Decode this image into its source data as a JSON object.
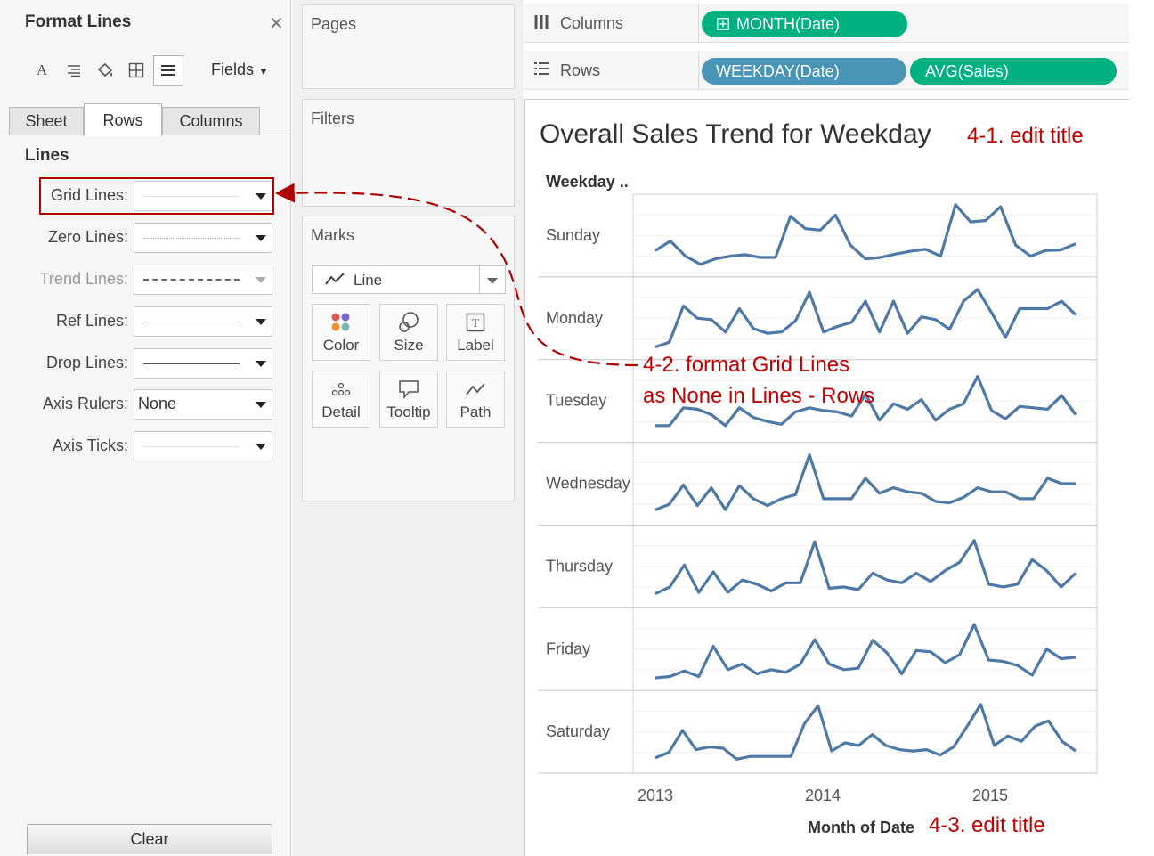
{
  "format_pane": {
    "title": "Format Lines",
    "toolbar_icons": [
      "font-icon",
      "alignment-icon",
      "shading-icon",
      "borders-icon",
      "lines-icon"
    ],
    "fields_label": "Fields",
    "tabs": [
      "Sheet",
      "Rows",
      "Columns"
    ],
    "active_tab": "Rows",
    "section_title": "Lines",
    "rows": [
      {
        "label": "Grid Lines:",
        "style": "faint",
        "value": ""
      },
      {
        "label": "Zero Lines:",
        "style": "dotted",
        "value": ""
      },
      {
        "label": "Trend Lines:",
        "style": "dashed",
        "value": "",
        "disabled": true
      },
      {
        "label": "Ref Lines:",
        "style": "solid",
        "value": ""
      },
      {
        "label": "Drop Lines:",
        "style": "solid",
        "value": ""
      },
      {
        "label": "Axis Rulers:",
        "style": "text",
        "value": "None"
      },
      {
        "label": "Axis Ticks:",
        "style": "faint",
        "value": ""
      }
    ],
    "clear_label": "Clear"
  },
  "cards": {
    "pages_title": "Pages",
    "filters_title": "Filters",
    "marks_title": "Marks",
    "mark_type": "Line",
    "mark_buttons": [
      "Color",
      "Size",
      "Label",
      "Detail",
      "Tooltip",
      "Path"
    ]
  },
  "shelves": {
    "columns_label": "Columns",
    "rows_label": "Rows",
    "columns_pills": [
      "MONTH(Date)"
    ],
    "rows_pills": [
      "WEEKDAY(Date)",
      "AVG(Sales)"
    ]
  },
  "viz": {
    "title": "Overall Sales Trend for Weekday",
    "row_header": "Weekday ..",
    "x_title": "Month of Date"
  },
  "annotations": {
    "a1": "4-1. edit title",
    "a2_line1": "4-2. format Grid Lines",
    "a2_line2": "as None in Lines - Rows",
    "a3": "4-3. edit title"
  },
  "colors": {
    "accent_line": "#4e79a7",
    "pill_green": "#00b180",
    "pill_blue": "#4a95b7",
    "annotation": "#c00000"
  },
  "chart_data": {
    "type": "line",
    "title": "Overall Sales Trend for Weekday",
    "xlabel": "Month of Date",
    "ylabel": "",
    "row_field": "Weekday ..",
    "x_ticks": [
      "2013",
      "2014",
      "2015"
    ],
    "x": [
      "2013-01",
      "2013-02",
      "2013-03",
      "2013-04",
      "2013-05",
      "2013-06",
      "2013-07",
      "2013-08",
      "2013-09",
      "2013-10",
      "2013-11",
      "2013-12",
      "2014-01",
      "2014-02",
      "2014-03",
      "2014-04",
      "2014-05",
      "2014-06",
      "2014-07",
      "2014-08",
      "2014-09",
      "2014-10",
      "2014-11",
      "2014-12",
      "2015-01",
      "2015-02",
      "2015-03",
      "2015-04",
      "2015-05",
      "2015-06",
      "2015-07"
    ],
    "panes": [
      {
        "name": "Sunday",
        "values": [
          0.28,
          0.42,
          0.2,
          0.08,
          0.16,
          0.2,
          0.22,
          0.18,
          0.18,
          0.78,
          0.6,
          0.58,
          0.8,
          0.36,
          0.16,
          0.18,
          0.23,
          0.27,
          0.3,
          0.2,
          0.95,
          0.7,
          0.72,
          0.92,
          0.36,
          0.2,
          0.28,
          0.29,
          0.38
        ]
      },
      {
        "name": "Monday",
        "values": [
          0.08,
          0.15,
          0.68,
          0.5,
          0.48,
          0.3,
          0.64,
          0.35,
          0.28,
          0.3,
          0.46,
          0.88,
          0.3,
          0.38,
          0.44,
          0.75,
          0.3,
          0.75,
          0.28,
          0.52,
          0.48,
          0.34,
          0.75,
          0.92,
          0.58,
          0.22,
          0.64,
          0.64,
          0.64,
          0.75,
          0.55
        ]
      },
      {
        "name": "Tuesday",
        "values": [
          0.14,
          0.14,
          0.4,
          0.38,
          0.3,
          0.14,
          0.4,
          0.26,
          0.2,
          0.16,
          0.34,
          0.4,
          0.36,
          0.34,
          0.28,
          0.6,
          0.22,
          0.46,
          0.38,
          0.52,
          0.22,
          0.38,
          0.46,
          0.86,
          0.36,
          0.24,
          0.42,
          0.4,
          0.38,
          0.58,
          0.3
        ]
      },
      {
        "name": "Wednesday",
        "values": [
          0.12,
          0.2,
          0.48,
          0.18,
          0.44,
          0.12,
          0.47,
          0.28,
          0.18,
          0.28,
          0.34,
          0.92,
          0.28,
          0.28,
          0.28,
          0.58,
          0.36,
          0.44,
          0.38,
          0.36,
          0.24,
          0.22,
          0.3,
          0.44,
          0.38,
          0.38,
          0.28,
          0.28,
          0.58,
          0.5,
          0.5
        ]
      },
      {
        "name": "Thursday",
        "values": [
          0.1,
          0.2,
          0.52,
          0.12,
          0.42,
          0.12,
          0.3,
          0.24,
          0.14,
          0.26,
          0.26,
          0.86,
          0.18,
          0.2,
          0.16,
          0.4,
          0.3,
          0.26,
          0.4,
          0.28,
          0.44,
          0.56,
          0.88,
          0.24,
          0.2,
          0.24,
          0.6,
          0.44,
          0.2,
          0.4
        ]
      },
      {
        "name": "Friday",
        "values": [
          0.08,
          0.1,
          0.18,
          0.1,
          0.54,
          0.2,
          0.28,
          0.14,
          0.2,
          0.16,
          0.28,
          0.64,
          0.28,
          0.2,
          0.22,
          0.63,
          0.44,
          0.14,
          0.48,
          0.46,
          0.3,
          0.42,
          0.86,
          0.34,
          0.32,
          0.26,
          0.12,
          0.5,
          0.36,
          0.38
        ]
      },
      {
        "name": "Saturday",
        "values": [
          0.12,
          0.2,
          0.52,
          0.24,
          0.28,
          0.26,
          0.1,
          0.14,
          0.14,
          0.14,
          0.14,
          0.62,
          0.88,
          0.22,
          0.34,
          0.3,
          0.46,
          0.3,
          0.24,
          0.22,
          0.24,
          0.16,
          0.28,
          0.58,
          0.9,
          0.3,
          0.44,
          0.36,
          0.58,
          0.66,
          0.36,
          0.22
        ]
      }
    ]
  }
}
